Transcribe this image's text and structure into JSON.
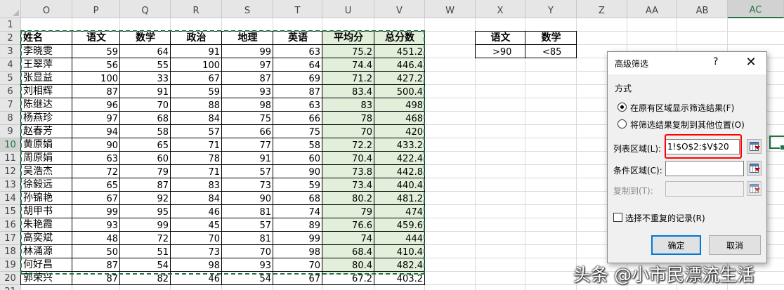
{
  "columns": [
    "O",
    "P",
    "Q",
    "R",
    "S",
    "T",
    "U",
    "V",
    "W",
    "X",
    "Y",
    "Z",
    "AA",
    "AB",
    "AC"
  ],
  "selected_column": "AC",
  "selected_row": "10",
  "rows": [
    "1",
    "2",
    "3",
    "4",
    "5",
    "6",
    "7",
    "8",
    "9",
    "10",
    "11",
    "12",
    "13",
    "14",
    "15",
    "16",
    "17",
    "18",
    "19",
    "20",
    "21"
  ],
  "table": {
    "headers": [
      "姓名",
      "语文",
      "数学",
      "政治",
      "地理",
      "英语",
      "平均分",
      "总分数"
    ],
    "records": [
      [
        "李晓雯",
        "59",
        "64",
        "91",
        "99",
        "63",
        "75.2",
        "451.2"
      ],
      [
        "王翠萍",
        "56",
        "55",
        "100",
        "97",
        "64",
        "74.4",
        "446.4"
      ],
      [
        "张显益",
        "100",
        "33",
        "67",
        "87",
        "69",
        "71.2",
        "427.2"
      ],
      [
        "刘相辉",
        "87",
        "91",
        "59",
        "93",
        "87",
        "83.4",
        "500.4"
      ],
      [
        "陈继达",
        "96",
        "70",
        "88",
        "98",
        "63",
        "83",
        "498"
      ],
      [
        "杨燕珍",
        "97",
        "68",
        "84",
        "75",
        "66",
        "78",
        "468"
      ],
      [
        "赵春芳",
        "94",
        "58",
        "57",
        "66",
        "75",
        "70",
        "420"
      ],
      [
        "黄原娟",
        "90",
        "65",
        "71",
        "77",
        "58",
        "72.2",
        "433.2"
      ],
      [
        "周原娟",
        "63",
        "60",
        "78",
        "91",
        "60",
        "70.4",
        "422.4"
      ],
      [
        "吴浩杰",
        "72",
        "79",
        "71",
        "57",
        "90",
        "73.8",
        "442.8"
      ],
      [
        "徐毅远",
        "65",
        "87",
        "83",
        "73",
        "59",
        "73.4",
        "440.4"
      ],
      [
        "孙锦艳",
        "67",
        "92",
        "84",
        "90",
        "68",
        "80.2",
        "481.2"
      ],
      [
        "胡甲书",
        "99",
        "95",
        "46",
        "81",
        "74",
        "79",
        "474"
      ],
      [
        "朱艳霞",
        "93",
        "99",
        "45",
        "57",
        "89",
        "76.6",
        "459.6"
      ],
      [
        "高奕斌",
        "48",
        "72",
        "70",
        "81",
        "99",
        "74",
        "444"
      ],
      [
        "林涌源",
        "50",
        "51",
        "73",
        "70",
        "98",
        "68.4",
        "410.4"
      ],
      [
        "何好昌",
        "87",
        "54",
        "98",
        "93",
        "70",
        "80.4",
        "482.4"
      ],
      [
        "郭荣兴",
        "87",
        "82",
        "46",
        "54",
        "67",
        "67.2",
        "403.2"
      ]
    ]
  },
  "criteria": {
    "headers": [
      "语文",
      "数学"
    ],
    "values": [
      ">90",
      "<85"
    ]
  },
  "dialog": {
    "title": "高级筛选",
    "help": "?",
    "close": "✕",
    "method_label": "方式",
    "option1": "在原有区域显示筛选结果(F)",
    "option2": "将筛选结果复制到其他位置(O)",
    "list_range_label": "列表区域(L):",
    "list_range_value": "1!$O$2:$V$20",
    "criteria_range_label": "条件区域(C):",
    "criteria_range_value": "",
    "copy_to_label": "复制到(T):",
    "unique_label": "选择不重复的记录(R)",
    "ok": "确定",
    "cancel": "取消"
  },
  "watermark": "头条 @小市民漂流生活",
  "colors": {
    "accent": "#217346",
    "highlight": "#e2efda",
    "callout": "#ff0000"
  }
}
